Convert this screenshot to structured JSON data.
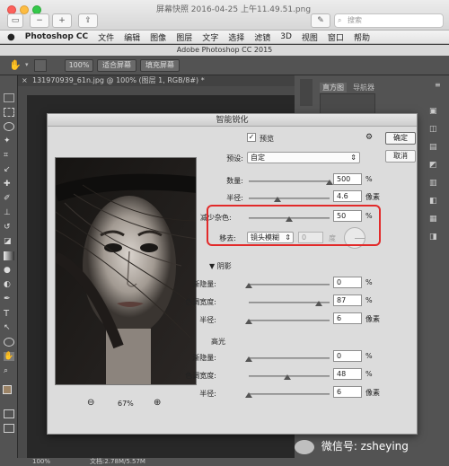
{
  "preview_window": {
    "title": "屏幕快照 2016-04-25 上午11.49.51.png",
    "search_placeholder": "搜索"
  },
  "menubar": {
    "app": "Photoshop CC",
    "items": [
      "文件",
      "编辑",
      "图像",
      "图层",
      "文字",
      "选择",
      "滤镜",
      "3D",
      "视图",
      "窗口",
      "帮助"
    ]
  },
  "ps": {
    "window_title": "Adobe Photoshop CC 2015",
    "options": [
      "100%",
      "适合屏幕",
      "填充屏幕"
    ],
    "doc_tab": "131970939_61n.jpg @ 100% (图层 1, RGB/8#) *",
    "panel_tabs": [
      "直方图",
      "导航器"
    ],
    "status_zoom": "100%",
    "status_doc": "文档:2.78M/5.57M"
  },
  "dialog": {
    "title": "智能锐化",
    "preview_label": "预览",
    "ok": "确定",
    "cancel": "取消",
    "preset_label": "预设:",
    "preset_value": "自定",
    "zoom": "67%",
    "amount_label": "数量:",
    "amount_value": "500",
    "amount_unit": "%",
    "amount_level": 1.0,
    "radius_label": "半径:",
    "radius_value": "4.6",
    "radius_unit": "像素",
    "radius_level": 0.35,
    "noise_label": "减少杂色:",
    "noise_value": "50",
    "noise_unit": "%",
    "noise_level": 0.5,
    "remove_label": "移去:",
    "remove_value": "镜头模糊",
    "angle_value": "0",
    "angle_unit": "度",
    "shadow_section": "阴影",
    "sh_fade_label": "渐隐量:",
    "sh_fade_value": "0",
    "sh_fade_unit": "%",
    "sh_fade_level": 0.0,
    "sh_tonal_label": "色调宽度:",
    "sh_tonal_value": "87",
    "sh_tonal_unit": "%",
    "sh_tonal_level": 0.87,
    "sh_radius_label": "半径:",
    "sh_radius_value": "6",
    "sh_radius_unit": "像素",
    "sh_radius_level": 0.0,
    "highlight_section": "高光",
    "hl_fade_label": "渐隐量:",
    "hl_fade_value": "0",
    "hl_fade_unit": "%",
    "hl_fade_level": 0.0,
    "hl_tonal_label": "色调宽度:",
    "hl_tonal_value": "48",
    "hl_tonal_unit": "%",
    "hl_tonal_level": 0.48,
    "hl_radius_label": "半径:",
    "hl_radius_value": "6",
    "hl_radius_unit": "像素",
    "hl_radius_level": 0.0
  },
  "watermark": "微信号: zsheying",
  "colors": {
    "highlight_box": "#e22a2a",
    "accent": "#2a7bd6"
  }
}
